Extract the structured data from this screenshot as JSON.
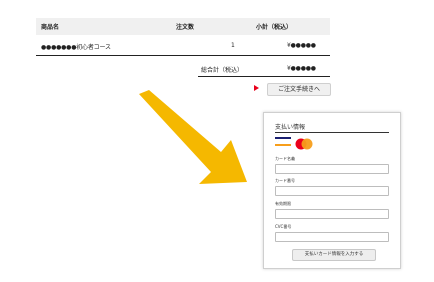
{
  "table": {
    "headers": {
      "product": "商品名",
      "qty": "注文数",
      "subtotal": "小計（税込）"
    },
    "rows": [
      {
        "product": "●●●●●●●初心者コース",
        "qty": "1",
        "price": "¥●●●●●"
      }
    ],
    "total_label": "総合計（税込）",
    "total_value": "¥●●●●●"
  },
  "proceed": {
    "label": "ご注文手続きへ"
  },
  "payment": {
    "title": "支払い情報",
    "card_name_label": "カード名義",
    "card_number_label": "カード番号",
    "expiry_label": "有効期限",
    "cvc_label": "CVC番号",
    "submit_label": "支払いカード情報を入力する"
  },
  "colors": {
    "arrow": "#f5b800",
    "accent_red": "#e8001c",
    "mc_red": "#eb001b",
    "mc_orange": "#f79e1b",
    "visa_blue": "#1a1f71"
  }
}
